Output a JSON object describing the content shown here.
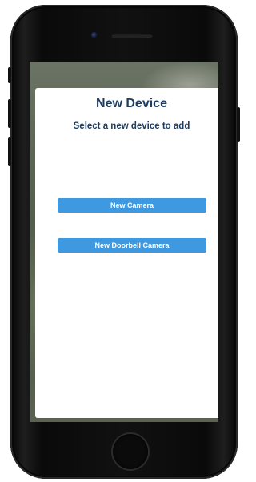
{
  "modal": {
    "title": "New Device",
    "subtitle": "Select a new device to add",
    "buttons": [
      {
        "label": "New Camera"
      },
      {
        "label": "New Doorbell Camera"
      }
    ]
  },
  "icons": {
    "close": "close-icon"
  },
  "colors": {
    "title_text": "#1d3d63",
    "button_bg": "#3f99e0",
    "button_text": "#ffffff",
    "modal_bg": "#ffffff"
  }
}
